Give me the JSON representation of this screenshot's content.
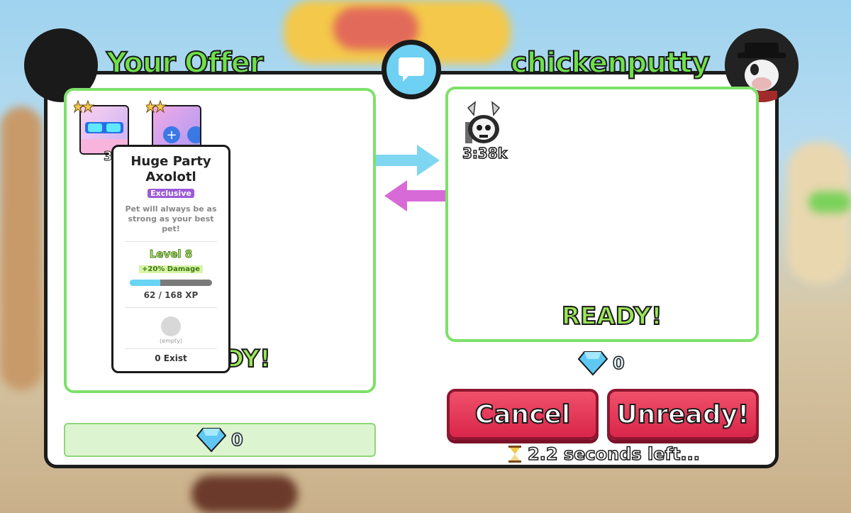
{
  "left": {
    "title": "Your Offer",
    "ready_label": "READY!",
    "gems": "0"
  },
  "right": {
    "title": "chickenputty",
    "ready_label": "READY!",
    "gems": "0",
    "pet_value": "3:38k"
  },
  "tooltip": {
    "name": "Huge Party Axolotl",
    "rarity": "Exclusive",
    "description": "Pet will always be as strong as your best pet!",
    "level": "Level 8",
    "bonus": "+20% Damage",
    "xp_text": "62 / 168 XP",
    "xp_fraction": 0.37,
    "enchant_slot": "(empty)",
    "exist_count": "0 Exist"
  },
  "left_card_badge": "3",
  "buttons": {
    "cancel": "Cancel",
    "unready": "Unready!"
  },
  "timer": {
    "icon": "hourglass-icon",
    "text": "2.2 seconds left..."
  },
  "colors": {
    "green_title": "#6fe04a",
    "box_border": "#7ee06a",
    "button_red": "#e0304f",
    "arrow_right": "#7fd6f0",
    "arrow_left": "#d86ad8",
    "rarity_purple": "#9c5ad8"
  }
}
